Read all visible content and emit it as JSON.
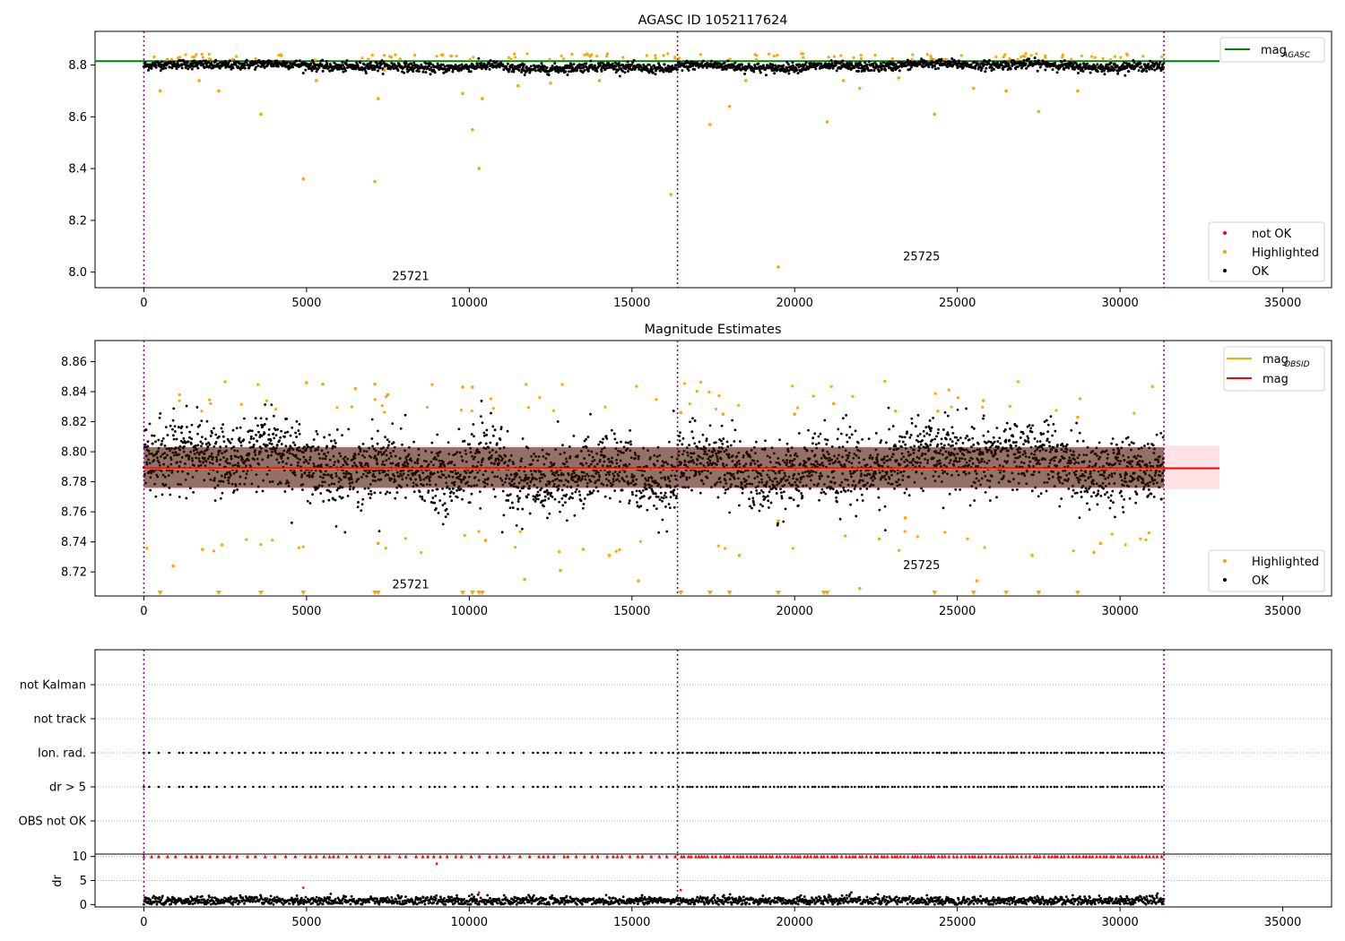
{
  "chart_data": [
    {
      "type": "scatter",
      "title": "AGASC ID 1052117624",
      "xlim": [
        -1500,
        36500
      ],
      "ylim": [
        7.94,
        8.93
      ],
      "yticks": [
        "8.0",
        "8.2",
        "8.4",
        "8.6",
        "8.8"
      ],
      "yticks_values": [
        8.0,
        8.2,
        8.4,
        8.6,
        8.8
      ],
      "xticks": [
        "0",
        "5000",
        "10000",
        "15000",
        "20000",
        "25000",
        "30000",
        "35000"
      ],
      "xticks_values": [
        0,
        5000,
        10000,
        15000,
        20000,
        25000,
        30000,
        35000
      ],
      "vlines": [
        0,
        16400,
        31350
      ],
      "obsid_labels": [
        {
          "text": "25721",
          "x": 8200,
          "y": 7.97
        },
        {
          "text": "25725",
          "x": 23900,
          "y": 8.045
        }
      ],
      "reference_line": {
        "name": "mag_AGASC",
        "y": 8.815,
        "color": "#008000"
      },
      "ok_band": {
        "center": 8.797,
        "spread": 0.018
      },
      "segment_means": [
        {
          "x": [
            0,
            16400
          ],
          "mean": 8.797
        },
        {
          "x": [
            16400,
            31350
          ],
          "mean": 8.795
        }
      ],
      "highlighted_points": [
        [
          500,
          8.7
        ],
        [
          1700,
          8.74
        ],
        [
          2300,
          8.7
        ],
        [
          3600,
          8.61
        ],
        [
          4900,
          8.36
        ],
        [
          5300,
          8.74
        ],
        [
          7100,
          8.35
        ],
        [
          7200,
          8.67
        ],
        [
          7400,
          8.78
        ],
        [
          9800,
          8.69
        ],
        [
          10100,
          8.55
        ],
        [
          10300,
          8.4
        ],
        [
          10400,
          8.67
        ],
        [
          11500,
          8.72
        ],
        [
          12500,
          8.73
        ],
        [
          14000,
          8.74
        ],
        [
          16200,
          8.3
        ],
        [
          17400,
          8.57
        ],
        [
          18000,
          8.64
        ],
        [
          18500,
          8.74
        ],
        [
          19500,
          8.02
        ],
        [
          21000,
          8.58
        ],
        [
          21500,
          8.74
        ],
        [
          22000,
          8.71
        ],
        [
          23200,
          8.75
        ],
        [
          24300,
          8.61
        ],
        [
          25500,
          8.71
        ],
        [
          26500,
          8.7
        ],
        [
          27500,
          8.62
        ],
        [
          28700,
          8.7
        ]
      ],
      "legend": {
        "lines": [
          "mag_AGASC"
        ],
        "points": [
          {
            "label": "not OK",
            "color": "#ff0000"
          },
          {
            "label": "Highlighted",
            "color": "#ffa500"
          },
          {
            "label": "OK",
            "color": "#000000"
          }
        ]
      }
    },
    {
      "type": "scatter",
      "title": "Magnitude Estimates",
      "xlim": [
        -1500,
        36500
      ],
      "ylim": [
        8.704,
        8.874
      ],
      "yticks": [
        "8.72",
        "8.74",
        "8.76",
        "8.78",
        "8.80",
        "8.82",
        "8.84",
        "8.86"
      ],
      "yticks_values": [
        8.72,
        8.74,
        8.76,
        8.78,
        8.8,
        8.82,
        8.84,
        8.86
      ],
      "xticks": [
        "0",
        "5000",
        "10000",
        "15000",
        "20000",
        "25000",
        "30000",
        "35000"
      ],
      "xticks_values": [
        0,
        5000,
        10000,
        15000,
        20000,
        25000,
        30000,
        35000
      ],
      "vlines": [
        0,
        16400,
        31350
      ],
      "obsid_labels": [
        {
          "text": "25721",
          "x": 8200,
          "y": 8.709
        },
        {
          "text": "25725",
          "x": 23900,
          "y": 8.722
        }
      ],
      "mag_line": {
        "name": "mag",
        "y": 8.789,
        "color": "#ff0000"
      },
      "mag_band": {
        "low": 8.775,
        "high": 8.804,
        "color": "#ffc0c4"
      },
      "obsid_mag": [
        {
          "x": [
            0,
            16400
          ],
          "y": 8.789,
          "color": "#ffa500"
        },
        {
          "x": [
            16400,
            31350
          ],
          "y": 8.789,
          "color": "#ffa500"
        }
      ],
      "highlighted_points": [
        [
          900,
          8.724
        ],
        [
          1800,
          8.735
        ],
        [
          2400,
          8.738
        ],
        [
          5000,
          8.846
        ],
        [
          5500,
          8.845
        ],
        [
          6500,
          8.842
        ],
        [
          7100,
          8.845
        ],
        [
          7200,
          8.739
        ],
        [
          7500,
          8.838
        ],
        [
          9800,
          8.843
        ],
        [
          10100,
          8.843
        ],
        [
          10500,
          8.741
        ],
        [
          11700,
          8.715
        ],
        [
          12800,
          8.721
        ],
        [
          13500,
          8.735
        ],
        [
          14300,
          8.731
        ],
        [
          15200,
          8.714
        ],
        [
          16500,
          8.826
        ],
        [
          17800,
          8.825
        ],
        [
          18300,
          8.731
        ],
        [
          19500,
          8.754
        ],
        [
          20000,
          8.825
        ],
        [
          21200,
          8.832
        ],
        [
          22000,
          8.709
        ],
        [
          22600,
          8.742
        ],
        [
          23100,
          8.827
        ],
        [
          23400,
          8.756
        ],
        [
          24400,
          8.827
        ],
        [
          25600,
          8.714
        ],
        [
          25800,
          8.834
        ],
        [
          27300,
          8.731
        ],
        [
          28700,
          8.823
        ],
        [
          29200,
          8.733
        ],
        [
          29400,
          8.739
        ]
      ],
      "offscale_markers": [
        500,
        2300,
        3600,
        4900,
        7100,
        7200,
        9800,
        10100,
        10300,
        10400,
        16500,
        17400,
        18000,
        19500,
        20900,
        21000,
        24300,
        25500,
        26500,
        27500,
        28700
      ],
      "legend": {
        "lines": [
          "mag_OBSID",
          "mag"
        ],
        "points": [
          {
            "label": "Highlighted",
            "color": "#ffa500"
          },
          {
            "label": "OK",
            "color": "#000000"
          }
        ]
      }
    },
    {
      "type": "scatter",
      "title": "",
      "xlim": [
        -1500,
        36500
      ],
      "categories": [
        "not Kalman",
        "not track",
        "Ion. rad.",
        "dr > 5",
        "OBS not OK"
      ],
      "flag_rows": [
        "Ion. rad.",
        "dr > 5"
      ]
    },
    {
      "type": "scatter",
      "title": "",
      "ylabel": "dr",
      "xlim": [
        -1500,
        36500
      ],
      "ylim": [
        -0.5,
        10.5
      ],
      "yticks": [
        "0",
        "5",
        "10"
      ],
      "yticks_values": [
        0,
        5,
        10
      ],
      "xticks": [
        "0",
        "5000",
        "10000",
        "15000",
        "20000",
        "25000",
        "30000",
        "35000"
      ],
      "xticks_values": [
        0,
        5000,
        10000,
        15000,
        20000,
        25000,
        30000,
        35000
      ],
      "vlines": [
        0,
        16400,
        31350
      ],
      "cap_value": 10,
      "outliers": [
        [
          4900,
          3.5
        ],
        [
          9000,
          8.5
        ],
        [
          10300,
          2.5
        ],
        [
          16500,
          3.0
        ]
      ]
    }
  ]
}
